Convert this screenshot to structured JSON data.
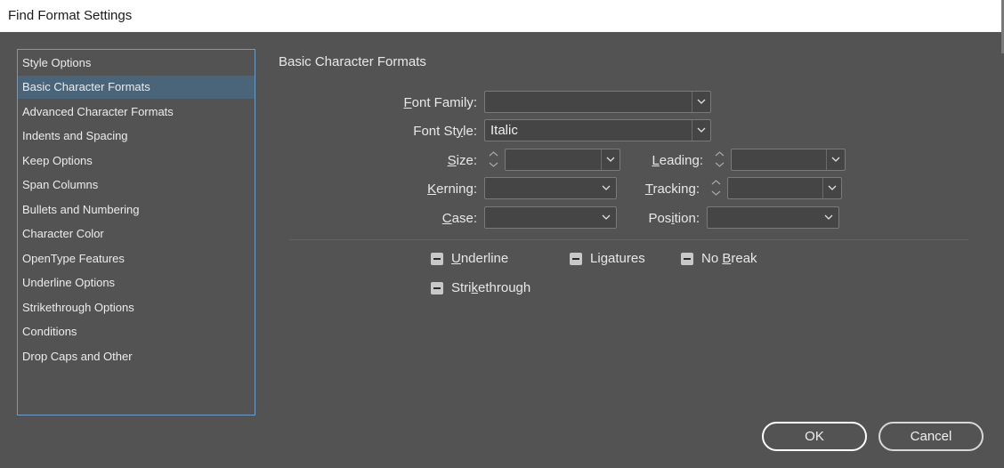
{
  "window": {
    "title": "Find Format Settings"
  },
  "sidebar": {
    "items": [
      {
        "label": "Style Options",
        "selected": false
      },
      {
        "label": "Basic Character Formats",
        "selected": true
      },
      {
        "label": "Advanced Character Formats",
        "selected": false
      },
      {
        "label": "Indents and Spacing",
        "selected": false
      },
      {
        "label": "Keep Options",
        "selected": false
      },
      {
        "label": "Span Columns",
        "selected": false
      },
      {
        "label": "Bullets and Numbering",
        "selected": false
      },
      {
        "label": "Character Color",
        "selected": false
      },
      {
        "label": "OpenType Features",
        "selected": false
      },
      {
        "label": "Underline Options",
        "selected": false
      },
      {
        "label": "Strikethrough Options",
        "selected": false
      },
      {
        "label": "Conditions",
        "selected": false
      },
      {
        "label": "Drop Caps and Other",
        "selected": false
      }
    ]
  },
  "main": {
    "section_title": "Basic Character Formats",
    "fields": {
      "font_family": {
        "pre": "",
        "key": "F",
        "post": "ont Family:",
        "value": ""
      },
      "font_style": {
        "pre": "Font St",
        "key": "y",
        "post": "le:",
        "value": "Italic"
      },
      "size": {
        "pre": "",
        "key": "S",
        "post": "ize:",
        "value": ""
      },
      "leading": {
        "pre": "",
        "key": "L",
        "post": "eading:",
        "value": ""
      },
      "kerning": {
        "pre": "",
        "key": "K",
        "post": "erning:",
        "value": ""
      },
      "tracking": {
        "pre": "",
        "key": "T",
        "post": "racking:",
        "value": ""
      },
      "case": {
        "pre": "",
        "key": "C",
        "post": "ase:",
        "value": ""
      },
      "position": {
        "pre": "Pos",
        "key": "i",
        "post": "tion:",
        "value": ""
      }
    },
    "checkboxes": {
      "underline": {
        "pre": "",
        "key": "U",
        "post": "nderline",
        "state": "indeterminate"
      },
      "ligatures": {
        "pre": "Li",
        "key": "g",
        "post": "atures",
        "state": "indeterminate"
      },
      "no_break": {
        "pre": "No ",
        "key": "B",
        "post": "reak",
        "state": "indeterminate"
      },
      "strikethrough": {
        "pre": "Stri",
        "key": "k",
        "post": "ethrough",
        "state": "indeterminate"
      }
    }
  },
  "buttons": {
    "ok": "OK",
    "cancel": "Cancel"
  },
  "icons": {
    "dropdown": "chevron-down-icon",
    "spinner": "spinner-arrows-icon",
    "checkbox": "checkbox-indeterminate-icon"
  },
  "colors": {
    "background": "#535353",
    "selection": "#4a6479",
    "list_border": "#6e9cc7"
  }
}
